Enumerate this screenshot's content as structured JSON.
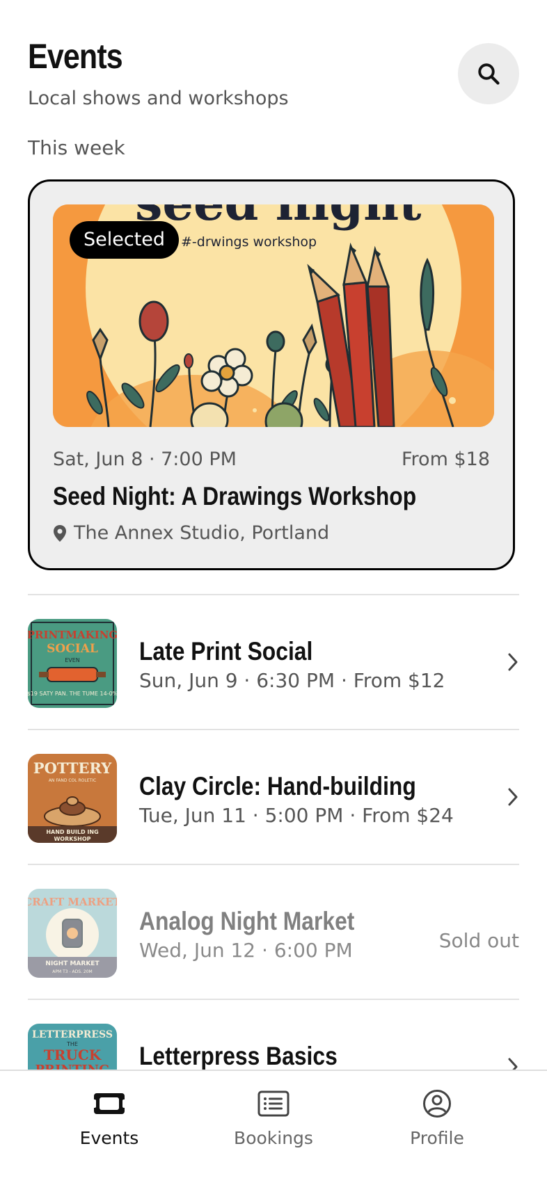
{
  "header": {
    "title": "Events",
    "subtitle": "Local shows and workshops"
  },
  "search": {
    "icon": "search-icon"
  },
  "section_label": "This week",
  "featured": {
    "badge": "Selected",
    "poster_title": "seed night",
    "poster_subtitle": "#-drwings workshop",
    "date": "Sat, Jun 8 · 7:00 PM",
    "price": "From $18",
    "title": "Seed Night: A Drawings Workshop",
    "venue": "The Annex Studio, Portland"
  },
  "events": [
    {
      "title": "Late Print Social",
      "meta": "Sun, Jun 9 · 6:30 PM · From $12",
      "thumb_text": [
        "PRINTMAKING",
        "SOCIAL",
        "EVEN",
        "$19 SATY PAN. THE TUME 14-0%"
      ],
      "status": ""
    },
    {
      "title": "Clay Circle: Hand-building",
      "meta": "Tue, Jun 11 · 5:00 PM · From $24",
      "thumb_text": [
        "POTTERY",
        "AN FAND COL ROLETIC",
        "HAND BUILD ING",
        "WORKSHOP"
      ],
      "status": ""
    },
    {
      "title": "Analog Night Market",
      "meta": "Wed, Jun 12 · 6:00 PM",
      "thumb_text": [
        "CRAFT MARKET",
        "NIGHT MARKET",
        "APM T3 - ADS. 20M"
      ],
      "status": "Sold out"
    },
    {
      "title": "Letterpress Basics",
      "meta": "",
      "thumb_text": [
        "LETTERPRESS",
        "THE",
        "TRUCK",
        "PRINTING"
      ],
      "status": ""
    }
  ],
  "tabs": [
    {
      "label": "Events",
      "icon": "ticket-icon",
      "active": true
    },
    {
      "label": "Bookings",
      "icon": "list-icon",
      "active": false
    },
    {
      "label": "Profile",
      "icon": "user-circle-icon",
      "active": false
    }
  ],
  "colors": {
    "accent": "#000000",
    "card_bg": "#eeeeee",
    "muted_text": "#555555",
    "poster_orange": "#f5993f",
    "poster_sun": "#fbe3a5"
  }
}
